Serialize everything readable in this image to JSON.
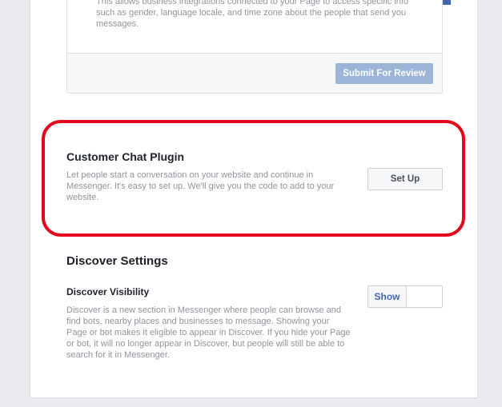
{
  "integrations": {
    "description": "This allows business integrations connected to your Page to access specific info such as gender, language locale, and time zone about the people that send you messages.",
    "submit_label": "Submit For Review"
  },
  "customer_chat": {
    "title": "Customer Chat Plugin",
    "description": "Let people start a conversation on your website and continue in Messenger. It's easy to set up. We'll give you the code to add to your website.",
    "setup_label": "Set Up"
  },
  "discover": {
    "heading": "Discover Settings",
    "visibility_title": "Discover Visibility",
    "visibility_description": "Discover is a new section in Messenger where people can browse and find bots, nearby places and businesses to message. Showing your Page or bot makes it eligible to appear in Discover. If you hide your Page or bot, it will no longer appear in Discover, but people will still be able to search for it in Messenger.",
    "toggle_show_label": "Show"
  },
  "colors": {
    "highlight": "#e3081d",
    "accent": "#4267b2"
  }
}
